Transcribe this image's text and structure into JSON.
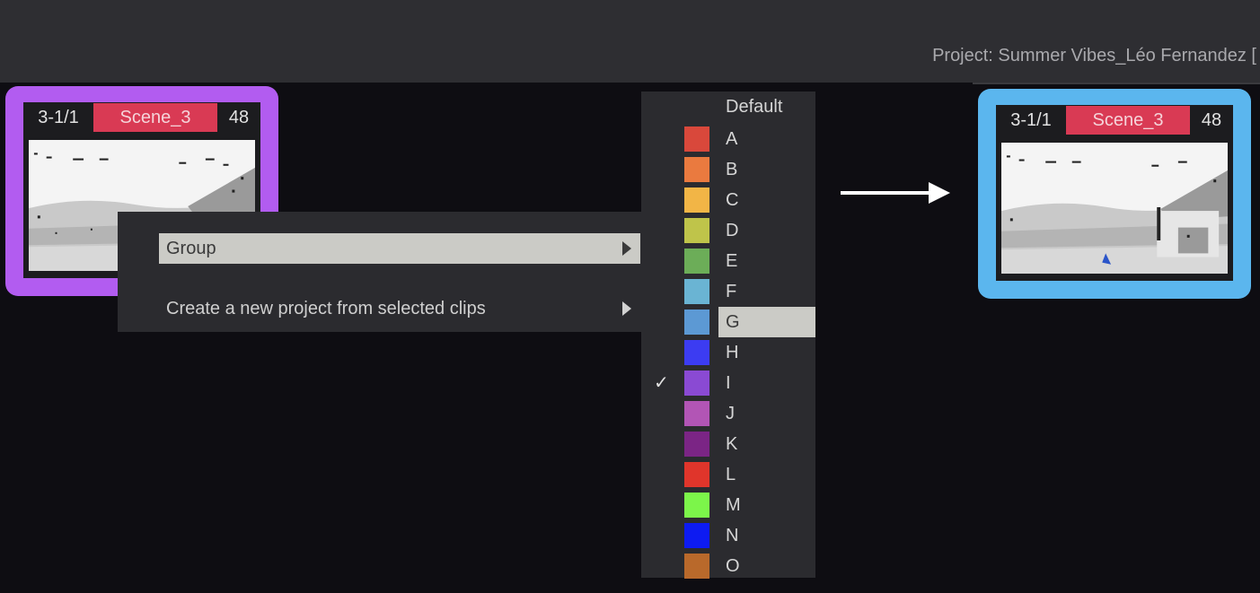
{
  "header": {
    "project_title": "Project: Summer Vibes_Léo Fernandez ["
  },
  "clips": {
    "before": {
      "timecode": "3-1/1",
      "scene": "Scene_3",
      "count": "48",
      "border_color": "#b25cf0"
    },
    "after": {
      "timecode": "3-1/1",
      "scene": "Scene_3",
      "count": "48",
      "border_color": "#5bb6ee"
    }
  },
  "context_menu": {
    "items": [
      {
        "label": "Group",
        "has_submenu": true,
        "highlighted": true
      },
      {
        "label": "Create a new project from selected clips",
        "has_submenu": true,
        "highlighted": false
      }
    ]
  },
  "group_submenu": {
    "default_label": "Default",
    "items": [
      {
        "label": "A",
        "color": "#d9483b"
      },
      {
        "label": "B",
        "color": "#ea7a3f"
      },
      {
        "label": "C",
        "color": "#f2b546"
      },
      {
        "label": "D",
        "color": "#bfc44a"
      },
      {
        "label": "E",
        "color": "#6cad58"
      },
      {
        "label": "F",
        "color": "#6ab4d3"
      },
      {
        "label": "G",
        "color": "#5c99d4",
        "highlighted": true
      },
      {
        "label": "H",
        "color": "#3c3cf2"
      },
      {
        "label": "I",
        "color": "#8a4ad3",
        "checked": true
      },
      {
        "label": "J",
        "color": "#b255b5"
      },
      {
        "label": "K",
        "color": "#7b2585"
      },
      {
        "label": "L",
        "color": "#e0352b"
      },
      {
        "label": "M",
        "color": "#7cf54a"
      },
      {
        "label": "N",
        "color": "#0d1bf2"
      },
      {
        "label": "O",
        "color": "#b9692b"
      }
    ]
  },
  "icons": {
    "checkmark": "check-icon",
    "arrow": "right-arrow-icon",
    "submenu": "chevron-right-icon"
  }
}
